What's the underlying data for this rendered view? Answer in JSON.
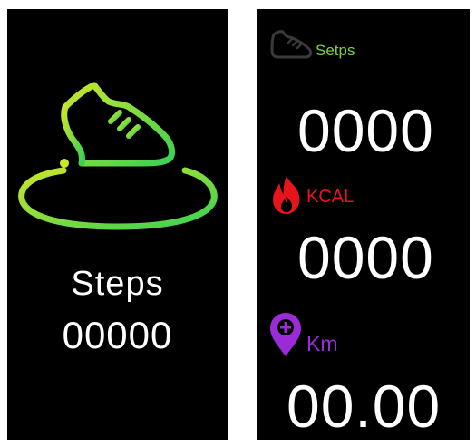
{
  "left_screen": {
    "icon": "running-shoe-on-ring-icon",
    "steps_label": "Steps",
    "steps_value": "00000"
  },
  "right_screen": {
    "steps": {
      "icon": "shoe-icon",
      "label": "Setps",
      "value": "0000",
      "color": "#7fcf4a"
    },
    "kcal": {
      "icon": "flame-icon",
      "label": "KCAL",
      "value": "0000",
      "color": "#e8141c"
    },
    "km": {
      "icon": "location-pin-plus-icon",
      "label": "Km",
      "value": "00.00",
      "color": "#9b2bd6"
    }
  },
  "colors": {
    "background": "#000000",
    "gradient_start": "#b6e234",
    "gradient_end": "#2fd15a"
  }
}
